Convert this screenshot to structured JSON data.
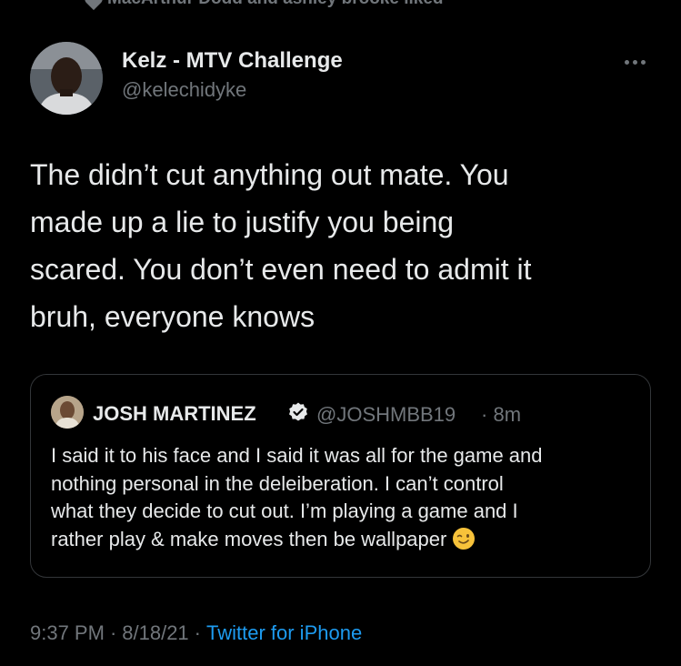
{
  "social_context": {
    "text": "MacArthur Dodd and ashley brooke liked"
  },
  "tweet": {
    "display_name": "Kelz - MTV Challenge",
    "handle": "@kelechidyke",
    "text_lines": [
      "The didn’t cut anything out mate. You",
      "made up a lie to justify you being",
      "scared. You don’t even need to admit it",
      "bruh, everyone knows"
    ],
    "more_icon": "more-horizontal-icon"
  },
  "quoted_tweet": {
    "display_name": "JOSH MARTINEZ",
    "handle": "@JOSHMBB19",
    "separator": "·",
    "time": "8m",
    "text_lines": [
      "I said it to his face and I said it was all for the game and",
      "nothing personal in the deleiberation. I can’t control",
      "what they decide to cut out. I’m playing a game and I",
      "rather play & make moves then be wallpaper"
    ],
    "emoji": "winking-face-emoji",
    "verified_icon": "verified-badge-icon"
  },
  "meta": {
    "time": "9:37 PM",
    "sep1": "·",
    "date": "8/18/21",
    "sep2": "·",
    "source": "Twitter for iPhone"
  },
  "colors": {
    "background": "#000000",
    "text": "#e7e9ea",
    "secondary": "#71767b",
    "link": "#1d9bf0",
    "border": "#333639"
  }
}
